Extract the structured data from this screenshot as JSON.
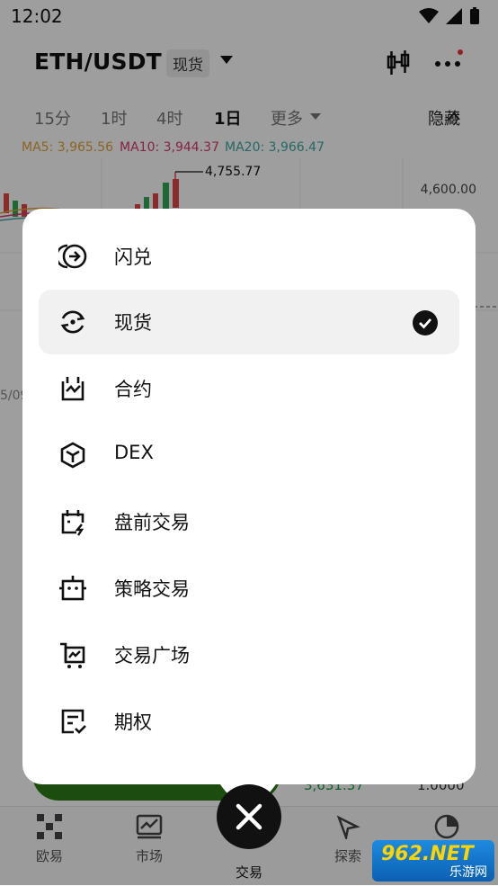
{
  "status_bar": {
    "time": "12:02"
  },
  "header": {
    "pair": "ETH/USDT",
    "market_badge": "现货"
  },
  "timeframes": [
    {
      "label": "15分"
    },
    {
      "label": "1时"
    },
    {
      "label": "4时"
    },
    {
      "label": "1日",
      "active": true
    },
    {
      "label": "更多"
    }
  ],
  "hide_label": "隐藏",
  "indicators": {
    "ma5": "MA5: 3,965.56",
    "ma10": "MA10: 3,944.37",
    "ma20": "MA20: 3,966.47"
  },
  "chart": {
    "high_label": "4,755.77",
    "axis_label": "4,600.00",
    "date_fragment": "5/09"
  },
  "order_book": {
    "row1_price": "3,631.37",
    "row1_amount": "1.0000"
  },
  "menu": {
    "items": [
      {
        "label": "闪兑",
        "icon": "swap-arrow-icon"
      },
      {
        "label": "现货",
        "icon": "spot-cycle-icon",
        "selected": true
      },
      {
        "label": "合约",
        "icon": "futures-icon"
      },
      {
        "label": "DEX",
        "icon": "cube-icon"
      },
      {
        "label": "盘前交易",
        "icon": "premarket-icon"
      },
      {
        "label": "策略交易",
        "icon": "bot-icon"
      },
      {
        "label": "交易广场",
        "icon": "trading-plaza-icon"
      },
      {
        "label": "期权",
        "icon": "options-icon"
      }
    ]
  },
  "bottom_nav": [
    {
      "label": "欧易",
      "icon": "okx-logo-icon"
    },
    {
      "label": "市场",
      "icon": "market-chart-icon"
    },
    {
      "label": "交易",
      "icon": "close-icon",
      "active": true
    },
    {
      "label": "探索",
      "icon": "compass-icon"
    },
    {
      "label": "资产",
      "icon": "pie-chart-icon"
    }
  ],
  "watermark": {
    "text": "962.NET",
    "sub": "乐游网"
  },
  "colors": {
    "ma5": "#e0a23a",
    "ma10": "#d9386e",
    "ma20": "#3fa7a7",
    "buy_green": "#2f7d18",
    "candle_red": "#e04848",
    "candle_green": "#2eaa55",
    "overlay": "rgba(0,0,0,0.38)"
  }
}
